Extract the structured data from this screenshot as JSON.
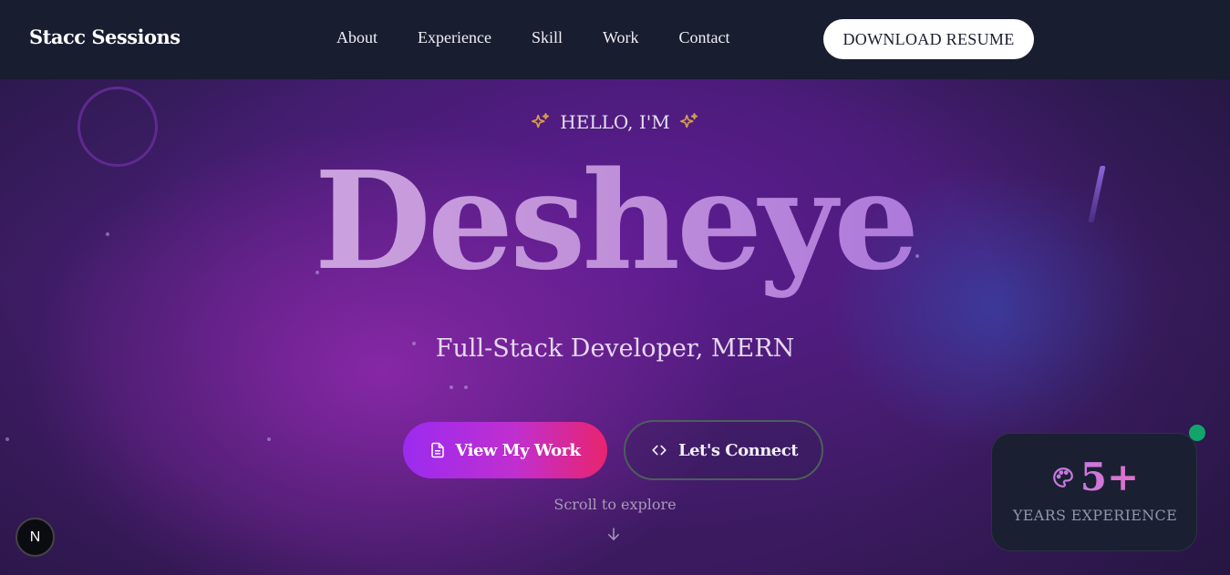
{
  "brand": "Stacc Sessions",
  "nav": {
    "links": [
      "About",
      "Experience",
      "Skill",
      "Work",
      "Contact"
    ],
    "resume_button": "DOWNLOAD RESUME"
  },
  "hero": {
    "greeting": "HELLO, I'M",
    "name": "Desheye",
    "role": "Full-Stack Developer, MERN",
    "primary_button": "View My Work",
    "secondary_button": "Let's Connect",
    "scroll_hint": "Scroll to explore"
  },
  "experience_card": {
    "value": "5+",
    "label": "YEARS EXPERIENCE"
  },
  "badge": "N",
  "colors": {
    "nav_bg": "#181d2f",
    "accent_purple": "#9b2bf0",
    "accent_pink": "#e9246f",
    "status_green": "#12a56b"
  },
  "icons": {
    "greeting": "sparkle-icon",
    "primary_button": "document-icon",
    "secondary_button": "code-icon",
    "scroll": "arrow-down-icon",
    "experience": "palette-icon"
  }
}
